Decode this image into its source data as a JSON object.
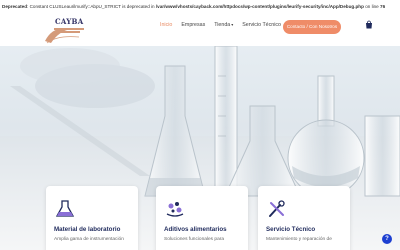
{
  "notice": {
    "label": "Deprecated",
    "message": ": Constant CLUSLeaurilmurify::AbpU_STRICT is deprecated in ",
    "path": "/var/www/vhosts/cayback.com/httpdocs/wp-content/plugins/leurify-security/inc/App/Debug.php",
    "line_label": " on line ",
    "line_number": "76"
  },
  "logo": {
    "text": "CAYBA"
  },
  "nav": {
    "items": [
      {
        "label": "Inicio",
        "active": true
      },
      {
        "label": "Empresas"
      },
      {
        "label": "Tienda"
      },
      {
        "label": "Servicio Técnico"
      }
    ],
    "caret": "▾"
  },
  "contact_button": "Contacto / Con Nosotros",
  "cards": [
    {
      "title": "Material de laboratorio",
      "desc": "Amplia gama de instrumentación",
      "icon": "lab-flask-icon"
    },
    {
      "title": "Aditivos alimentarios",
      "desc": "Soluciones funcionales para",
      "icon": "food-additives-icon"
    },
    {
      "title": "Servicio Técnico",
      "desc": "Mantenimiento y reparación de",
      "icon": "tools-icon"
    }
  ],
  "help": "?",
  "colors": {
    "accent": "#ef8c68",
    "navy": "#1f2a5c",
    "help": "#1d3fd1"
  }
}
